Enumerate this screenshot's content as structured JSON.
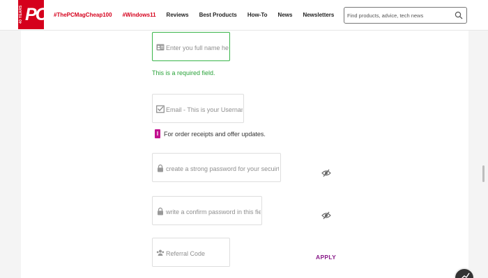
{
  "header": {
    "logo_years": "40 YEARS",
    "logo_text": "PC",
    "nav": [
      {
        "label": "#ThePCMagCheap100",
        "style": "red"
      },
      {
        "label": "#Windows11",
        "style": "red"
      },
      {
        "label": "Reviews",
        "style": "default"
      },
      {
        "label": "Best Products",
        "style": "default"
      },
      {
        "label": "How-To",
        "style": "default"
      },
      {
        "label": "News",
        "style": "default"
      },
      {
        "label": "Newsletters",
        "style": "default"
      }
    ],
    "search": {
      "placeholder": "Find products, advice, tech news",
      "icon": "search-icon"
    }
  },
  "form": {
    "full_name": {
      "placeholder": "Enter you full name here",
      "icon": "id-card-icon"
    },
    "required_message": "This is a required field.",
    "email": {
      "placeholder": "Email - This is your Username",
      "icon": "envelope-icon"
    },
    "email_note": {
      "badge": "I",
      "text": "For order receipts and offer updates."
    },
    "password": {
      "placeholder": "create a strong password for your secuirty",
      "icon": "lock-icon",
      "toggle_icon": "eye-slash-icon"
    },
    "confirm_password": {
      "placeholder": "write a confirm password in this field",
      "icon": "lock-icon",
      "toggle_icon": "eye-slash-icon"
    },
    "referral": {
      "placeholder": "Referral Code",
      "icon": "users-icon"
    },
    "apply_label": "APPLY"
  },
  "colors": {
    "brand_red": "#d5001c",
    "valid_green": "#39b54a",
    "note_magenta": "#c2118f",
    "apply_purple": "#8a1c8a"
  }
}
